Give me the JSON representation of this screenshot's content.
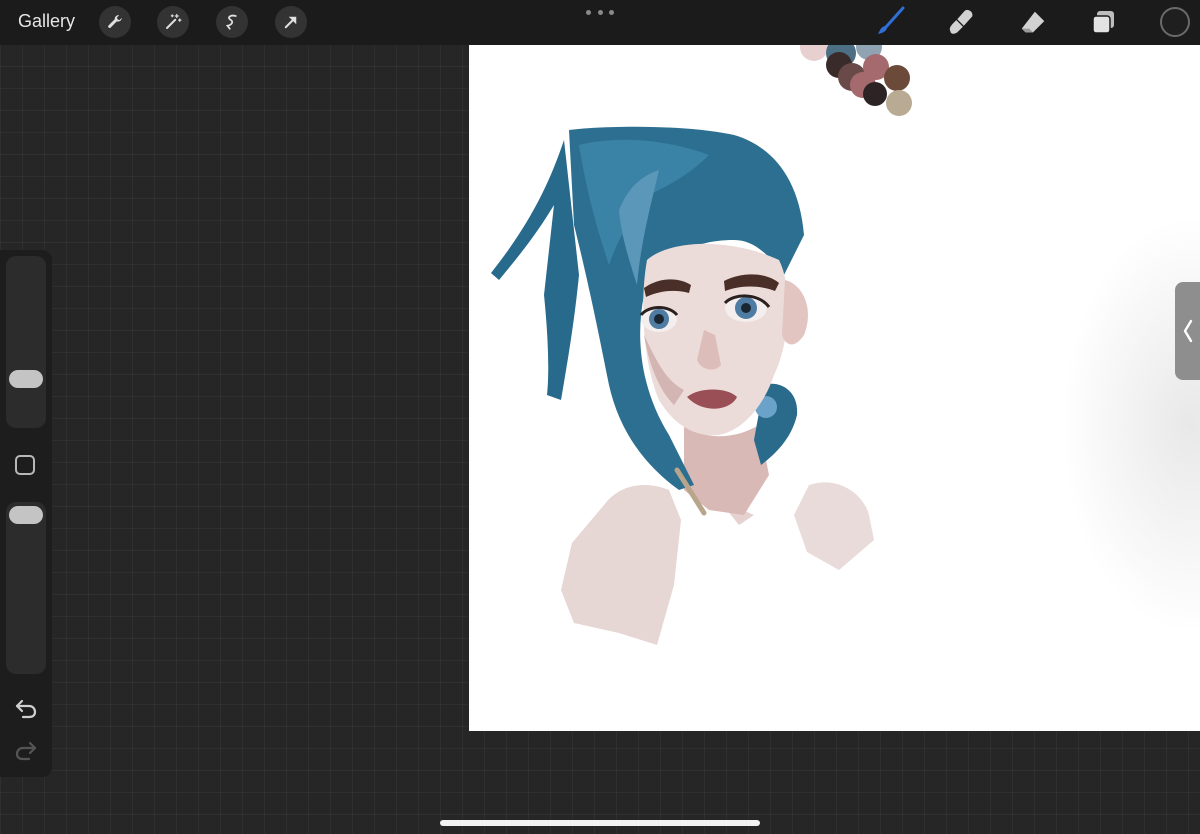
{
  "topbar": {
    "gallery_label": "Gallery",
    "left_tools": [
      "wrench-icon",
      "magic-wand-icon",
      "selection-icon",
      "transform-arrow-icon"
    ],
    "right_tools": [
      "brush-icon",
      "smudge-icon",
      "eraser-icon",
      "layers-icon"
    ],
    "active_tool": "brush-icon",
    "active_tool_color": "#2f6fd6",
    "current_color": "#1f1f1f"
  },
  "canvas": {
    "background": "#ffffff",
    "palette_swatches": [
      "#e8cfd0",
      "#4d6f83",
      "#8fa3b2",
      "#3a2b2b",
      "#6a4a48",
      "#a56a6e",
      "#2c2424",
      "#6b4a3a",
      "#b9ab93"
    ],
    "hair_color": "#2d6f90",
    "skin_color": "#e9d8d6"
  },
  "colors": {
    "workspace": "#262626",
    "topbar": "#1b1b1b",
    "sidebar": "#1d1d1d"
  }
}
